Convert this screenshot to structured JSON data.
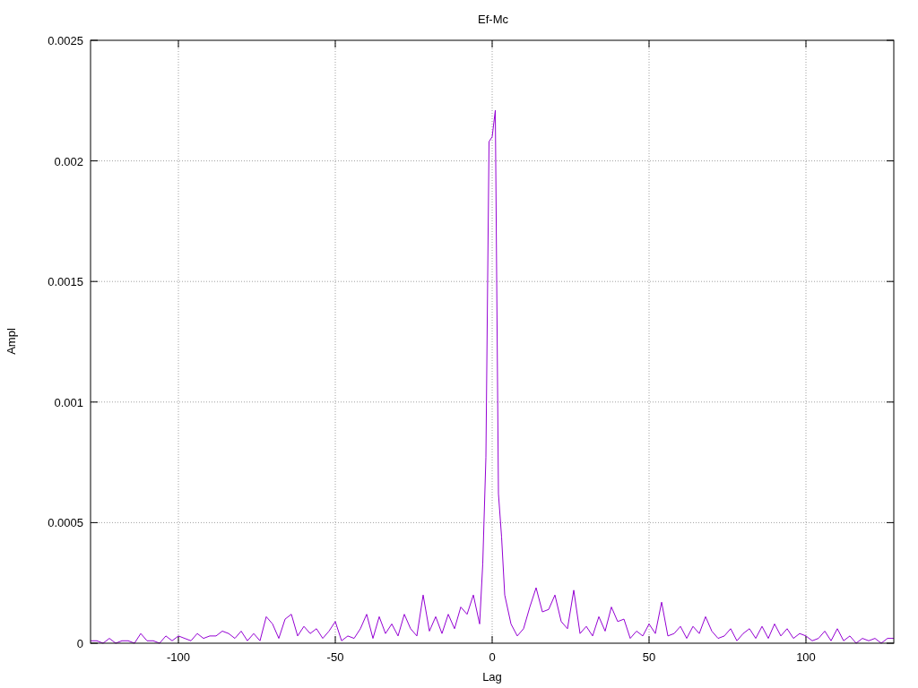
{
  "chart_data": {
    "type": "line",
    "title": "Ef-Mc",
    "xlabel": "Lag",
    "ylabel": "Ampl",
    "xlim": [
      -128,
      128
    ],
    "ylim": [
      0,
      0.0025
    ],
    "xticks": [
      -100,
      -50,
      0,
      50,
      100
    ],
    "yticks": [
      {
        "value": 0,
        "label": "0"
      },
      {
        "value": 0.0005,
        "label": "0.0005"
      },
      {
        "value": 0.001,
        "label": "0.001"
      },
      {
        "value": 0.0015,
        "label": "0.0015"
      },
      {
        "value": 0.002,
        "label": "0.002"
      },
      {
        "value": 0.0025,
        "label": "0.0025"
      }
    ],
    "x": [
      -128,
      -126,
      -124,
      -122,
      -120,
      -118,
      -116,
      -114,
      -112,
      -110,
      -108,
      -106,
      -104,
      -102,
      -100,
      -98,
      -96,
      -94,
      -92,
      -90,
      -88,
      -86,
      -84,
      -82,
      -80,
      -78,
      -76,
      -74,
      -72,
      -70,
      -68,
      -66,
      -64,
      -62,
      -60,
      -58,
      -56,
      -54,
      -52,
      -50,
      -48,
      -46,
      -44,
      -42,
      -40,
      -38,
      -36,
      -34,
      -32,
      -30,
      -28,
      -26,
      -24,
      -22,
      -20,
      -18,
      -16,
      -14,
      -12,
      -10,
      -8,
      -6,
      -4,
      -3,
      -2,
      -1,
      0,
      1,
      2,
      3,
      4,
      6,
      8,
      10,
      12,
      14,
      16,
      18,
      20,
      22,
      24,
      26,
      28,
      30,
      32,
      34,
      36,
      38,
      40,
      42,
      44,
      46,
      48,
      50,
      52,
      54,
      56,
      58,
      60,
      62,
      64,
      66,
      68,
      70,
      72,
      74,
      76,
      78,
      80,
      82,
      84,
      86,
      88,
      90,
      92,
      94,
      96,
      98,
      100,
      102,
      104,
      106,
      108,
      110,
      112,
      114,
      116,
      118,
      120,
      122,
      124,
      126,
      128
    ],
    "grid": true,
    "series": [
      {
        "color": "#9400d3",
        "values": [
          1e-05,
          1e-05,
          0,
          2e-05,
          0,
          1e-05,
          1e-05,
          0,
          4e-05,
          1e-05,
          1e-05,
          0,
          3e-05,
          1e-05,
          3e-05,
          2e-05,
          1e-05,
          4e-05,
          2e-05,
          3e-05,
          3e-05,
          5e-05,
          4e-05,
          2e-05,
          5e-05,
          1e-05,
          4e-05,
          1e-05,
          0.00011,
          8e-05,
          2e-05,
          0.0001,
          0.00012,
          3e-05,
          7e-05,
          4e-05,
          6e-05,
          2e-05,
          5e-05,
          9e-05,
          1e-05,
          3e-05,
          2e-05,
          6e-05,
          0.00012,
          2e-05,
          0.00011,
          4e-05,
          8e-05,
          3e-05,
          0.00012,
          6e-05,
          3e-05,
          0.0002,
          5e-05,
          0.00011,
          4e-05,
          0.00012,
          6e-05,
          0.00015,
          0.00012,
          0.0002,
          8e-05,
          0.00033,
          0.00077,
          0.00208,
          0.0021,
          0.00221,
          0.00062,
          0.00044,
          0.0002,
          8e-05,
          3e-05,
          6e-05,
          0.00015,
          0.00023,
          0.00013,
          0.00014,
          0.0002,
          9e-05,
          6e-05,
          0.00022,
          4e-05,
          7e-05,
          3e-05,
          0.00011,
          5e-05,
          0.00015,
          9e-05,
          0.0001,
          2e-05,
          5e-05,
          3e-05,
          8e-05,
          4e-05,
          0.00017,
          3e-05,
          4e-05,
          7e-05,
          2e-05,
          7e-05,
          4e-05,
          0.00011,
          5e-05,
          2e-05,
          3e-05,
          6e-05,
          1e-05,
          4e-05,
          6e-05,
          2e-05,
          7e-05,
          2e-05,
          8e-05,
          3e-05,
          6e-05,
          2e-05,
          4e-05,
          3e-05,
          1e-05,
          2e-05,
          5e-05,
          1e-05,
          6e-05,
          1e-05,
          3e-05,
          0,
          2e-05,
          1e-05,
          2e-05,
          0,
          2e-05,
          2e-05
        ]
      }
    ]
  }
}
